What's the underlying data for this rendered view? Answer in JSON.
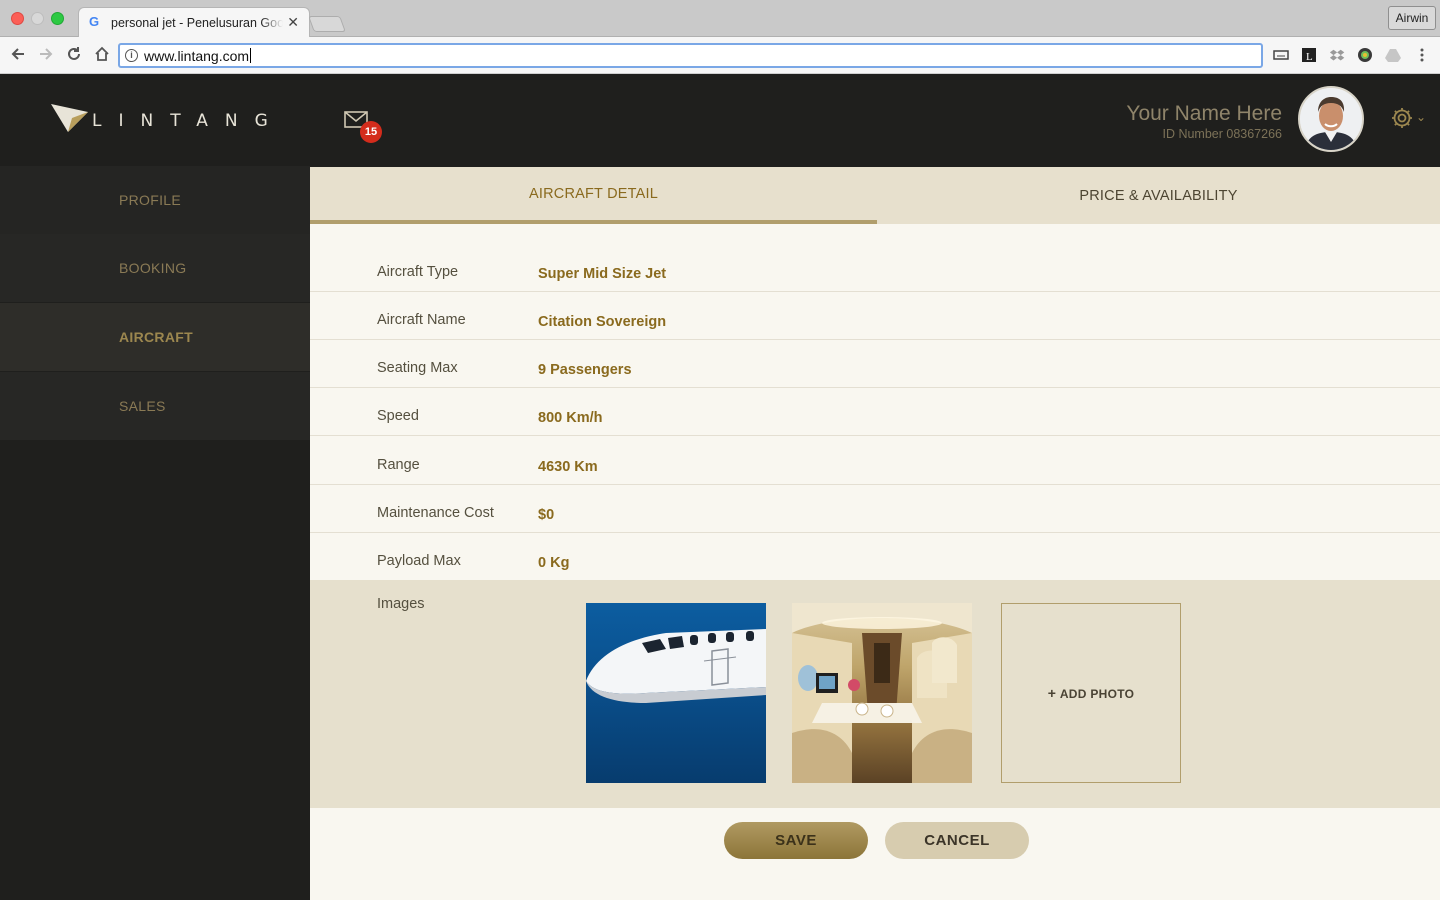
{
  "browser": {
    "tab_title": "personal jet - Penelusuran Google",
    "url": "www.lintang.com",
    "profile_label": "Airwin"
  },
  "app": {
    "brand": "LINTANG",
    "nav": [
      {
        "label": "PROFILE",
        "active": false
      },
      {
        "label": "BOOKING",
        "active": false
      },
      {
        "label": "AIRCRAFT",
        "active": true
      },
      {
        "label": "SALES",
        "active": false
      }
    ],
    "mail_count": "15",
    "user": {
      "name": "Your Name Here",
      "id_text": "ID Number 08367266"
    }
  },
  "tabs": [
    {
      "label": "AIRCRAFT DETAIL",
      "active": true
    },
    {
      "label": "PRICE & AVAILABILITY",
      "active": false
    }
  ],
  "detail": {
    "rows": [
      {
        "label": "Aircraft Type",
        "value": "Super Mid Size Jet"
      },
      {
        "label": "Aircraft Name",
        "value": "Citation Sovereign"
      },
      {
        "label": "Seating Max",
        "value": "9 Passengers"
      },
      {
        "label": "Speed",
        "value": "800 Km/h"
      },
      {
        "label": "Range",
        "value": "4630 Km"
      },
      {
        "label": "Maintenance Cost",
        "value": "$0"
      },
      {
        "label": "Payload Max",
        "value": "0 Kg"
      }
    ],
    "images_label": "Images",
    "add_photo_label": "ADD PHOTO"
  },
  "actions": {
    "save_label": "SAVE",
    "cancel_label": "CANCEL"
  },
  "colors": {
    "accent_gold": "#8a6a1e",
    "sidebar_bg": "#1f1f1d",
    "tabs_bg": "#e7e0cd",
    "content_bg": "#f9f7f0",
    "badge_red": "#d42c1c"
  }
}
